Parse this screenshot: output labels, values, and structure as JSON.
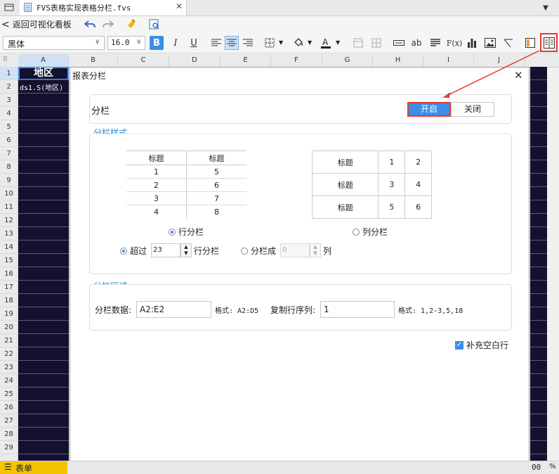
{
  "tab": {
    "filename": "FVS表格实现表格分栏.fvs"
  },
  "toolbar": {
    "back_label": "返回可视化看板",
    "font_name": "黑体",
    "font_size": "16.0",
    "bold": "B",
    "italic": "I",
    "underline": "U",
    "ab": "ab",
    "fx": "F(x)"
  },
  "grid": {
    "columns": [
      "A",
      "B",
      "C",
      "D",
      "E",
      "F",
      "G",
      "H",
      "I",
      "J"
    ],
    "rows": [
      "1",
      "2",
      "3",
      "4",
      "5",
      "6",
      "7",
      "8",
      "9",
      "10",
      "11",
      "12",
      "13",
      "14",
      "15",
      "16",
      "17",
      "18",
      "19",
      "20",
      "21",
      "22",
      "23",
      "24",
      "25",
      "26",
      "27",
      "28",
      "29"
    ],
    "cell_a1": "地区",
    "cell_a2": "ds1.S(地区)"
  },
  "dialog": {
    "title": "报表分栏",
    "section_fenlan": "分栏",
    "btn_open": "开启",
    "btn_close": "关闭",
    "style_title": "分栏样式",
    "row_preview": {
      "header": [
        "标题",
        "标题"
      ],
      "rows": [
        [
          "1",
          "5"
        ],
        [
          "2",
          "6"
        ],
        [
          "3",
          "7"
        ],
        [
          "4",
          "8"
        ]
      ]
    },
    "col_preview": {
      "rows": [
        [
          "标题",
          "1",
          "2"
        ],
        [
          "标题",
          "3",
          "4"
        ],
        [
          "标题",
          "5",
          "6"
        ]
      ]
    },
    "row_split_label": "行分栏",
    "col_split_label": "列分栏",
    "exceed_label": "超过",
    "exceed_value": "23",
    "exceed_suffix": "行分栏",
    "split_into_label": "分栏成",
    "split_into_value": "0",
    "split_into_suffix": "列",
    "area_title": "分栏区域",
    "data_label": "分栏数据:",
    "data_value": "A2:E2",
    "format1": "格式: A2:D5",
    "copy_label": "复制行序列:",
    "copy_value": "1",
    "format2": "格式: 1,2-3,5,18",
    "fill_blank_label": "补充空白行"
  },
  "statusbar": {
    "sheet": "表单",
    "zoom": "00",
    "pct": "%"
  },
  "colors": {
    "accent": "#3b8ee8",
    "highlight": "#e53935",
    "cell_bg": "#14112e",
    "title_blue": "#2a8bd0"
  }
}
